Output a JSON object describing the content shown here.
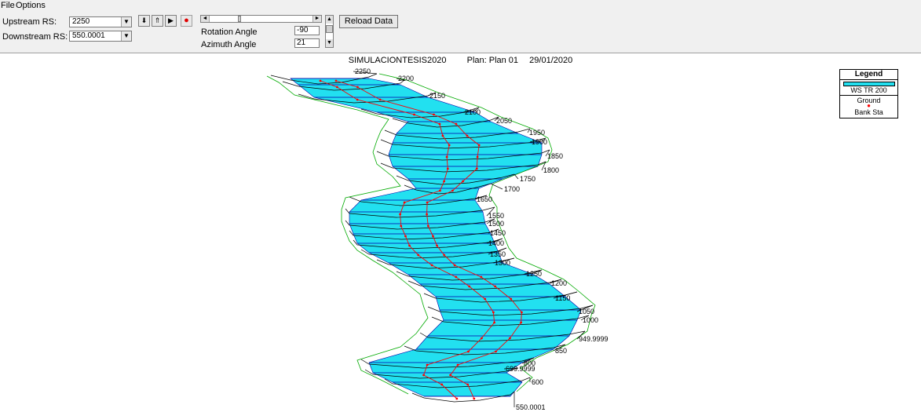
{
  "menu": [
    "File",
    "Options"
  ],
  "toolbar": {
    "upstream_label": "Upstream RS:",
    "upstream_value": "2250",
    "downstream_label": "Downstream RS:",
    "downstream_value": "550.0001",
    "rotation_label": "Rotation Angle",
    "rotation_value": "-90",
    "azimuth_label": "Azimuth Angle",
    "azimuth_value": "21",
    "reload_label": "Reload Data"
  },
  "plot": {
    "project": "SIMULACIONTESIS2020",
    "plan": "Plan: Plan 01",
    "date": "29/01/2020",
    "water_color": "#22e0f0",
    "ground_color": "#000000",
    "bank_color": "#ff0000",
    "reach_line_color": "#00aa00",
    "stations": [
      "2250",
      "2200",
      "2150",
      "2100",
      "2050",
      "1950",
      "1900",
      "1850",
      "1800",
      "1750",
      "1700",
      "1650",
      "1550",
      "1500",
      "1450",
      "1400",
      "1350",
      "1300",
      "1250",
      "1200",
      "1150",
      "1050",
      "1000",
      "949.9999",
      "850",
      "800",
      "699.9999",
      "600",
      "550.0001"
    ]
  },
  "legend": {
    "title": "Legend",
    "entries": [
      "WS TR 200",
      "Ground",
      "Bank Sta"
    ]
  }
}
